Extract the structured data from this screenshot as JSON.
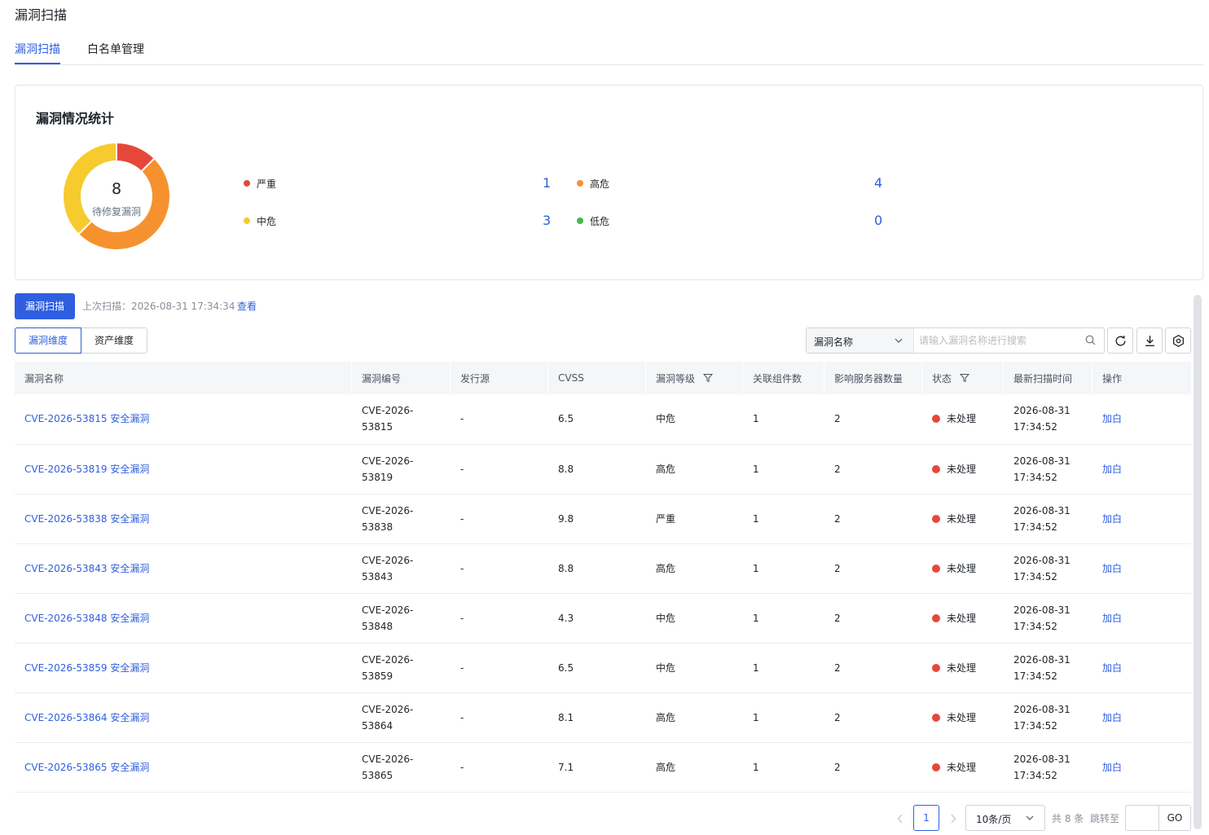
{
  "page": {
    "title": "漏洞扫描"
  },
  "tabs": [
    {
      "label": "漏洞扫描",
      "active": true
    },
    {
      "label": "白名单管理",
      "active": false
    }
  ],
  "stats": {
    "title": "漏洞情况统计",
    "total": "8",
    "total_label": "待修复漏洞",
    "levels": [
      {
        "label": "严重",
        "count": "1",
        "color": "#e5483a"
      },
      {
        "label": "高危",
        "count": "4",
        "color": "#f5922f"
      },
      {
        "label": "中危",
        "count": "3",
        "color": "#f7ca2e"
      },
      {
        "label": "低危",
        "count": "0",
        "color": "#3fb950"
      }
    ]
  },
  "chart_data": {
    "type": "pie",
    "categories": [
      "严重",
      "高危",
      "中危",
      "低危"
    ],
    "values": [
      1,
      4,
      3,
      0
    ],
    "colors": [
      "#e5483a",
      "#f5922f",
      "#f7ca2e",
      "#3fb950"
    ],
    "title": "漏洞情况统计",
    "center_value": "8",
    "center_label": "待修复漏洞"
  },
  "toolbar": {
    "scan_button": "漏洞扫描",
    "last_scan": "上次扫描：2026-08-31 17:34:34",
    "view_link": "查看",
    "segments": [
      {
        "label": "漏洞维度",
        "active": true
      },
      {
        "label": "资产维度",
        "active": false
      }
    ],
    "search_field": "漏洞名称",
    "search_placeholder": "请输入漏洞名称进行搜索",
    "icons": [
      "refresh-icon",
      "download-icon",
      "settings-icon",
      "search-icon",
      "filter-icon",
      "chevron-down-icon"
    ]
  },
  "table": {
    "columns": [
      "漏洞名称",
      "漏洞编号",
      "发行源",
      "CVSS",
      "漏洞等级",
      "关联组件数",
      "影响服务器数量",
      "状态",
      "最新扫描时间",
      "操作"
    ],
    "rows": [
      {
        "name": "CVE-2026-53815 安全漏洞",
        "id_1": "CVE-2026-",
        "id_2": "53815",
        "source": "-",
        "cvss": "6.5",
        "level": "中危",
        "components": "1",
        "servers": "2",
        "status": "未处理",
        "date": "2026-08-31",
        "time": "17:34:52",
        "action": "加白"
      },
      {
        "name": "CVE-2026-53819 安全漏洞",
        "id_1": "CVE-2026-",
        "id_2": "53819",
        "source": "-",
        "cvss": "8.8",
        "level": "高危",
        "components": "1",
        "servers": "2",
        "status": "未处理",
        "date": "2026-08-31",
        "time": "17:34:52",
        "action": "加白"
      },
      {
        "name": "CVE-2026-53838 安全漏洞",
        "id_1": "CVE-2026-",
        "id_2": "53838",
        "source": "-",
        "cvss": "9.8",
        "level": "严重",
        "components": "1",
        "servers": "2",
        "status": "未处理",
        "date": "2026-08-31",
        "time": "17:34:52",
        "action": "加白"
      },
      {
        "name": "CVE-2026-53843 安全漏洞",
        "id_1": "CVE-2026-",
        "id_2": "53843",
        "source": "-",
        "cvss": "8.8",
        "level": "高危",
        "components": "1",
        "servers": "2",
        "status": "未处理",
        "date": "2026-08-31",
        "time": "17:34:52",
        "action": "加白"
      },
      {
        "name": "CVE-2026-53848 安全漏洞",
        "id_1": "CVE-2026-",
        "id_2": "53848",
        "source": "-",
        "cvss": "4.3",
        "level": "中危",
        "components": "1",
        "servers": "2",
        "status": "未处理",
        "date": "2026-08-31",
        "time": "17:34:52",
        "action": "加白"
      },
      {
        "name": "CVE-2026-53859 安全漏洞",
        "id_1": "CVE-2026-",
        "id_2": "53859",
        "source": "-",
        "cvss": "6.5",
        "level": "中危",
        "components": "1",
        "servers": "2",
        "status": "未处理",
        "date": "2026-08-31",
        "time": "17:34:52",
        "action": "加白"
      },
      {
        "name": "CVE-2026-53864 安全漏洞",
        "id_1": "CVE-2026-",
        "id_2": "53864",
        "source": "-",
        "cvss": "8.1",
        "level": "高危",
        "components": "1",
        "servers": "2",
        "status": "未处理",
        "date": "2026-08-31",
        "time": "17:34:52",
        "action": "加白"
      },
      {
        "name": "CVE-2026-53865 安全漏洞",
        "id_1": "CVE-2026-",
        "id_2": "53865",
        "source": "-",
        "cvss": "7.1",
        "level": "高危",
        "components": "1",
        "servers": "2",
        "status": "未处理",
        "date": "2026-08-31",
        "time": "17:34:52",
        "action": "加白"
      }
    ]
  },
  "pagination": {
    "current_page": "1",
    "page_size": "10条/页",
    "total": "共 8 条",
    "jump_label": "跳转至",
    "go_label": "GO"
  }
}
